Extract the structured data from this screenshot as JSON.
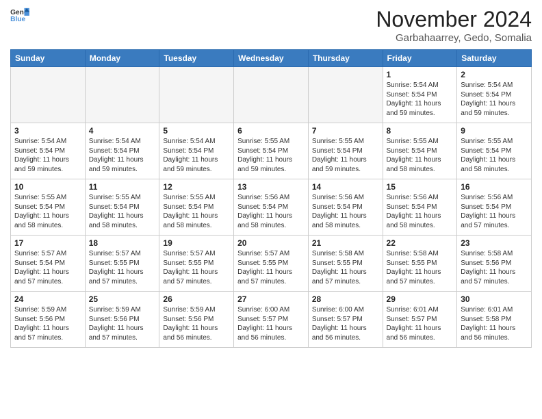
{
  "header": {
    "logo_general": "General",
    "logo_blue": "Blue",
    "month_title": "November 2024",
    "location": "Garbahaarrey, Gedo, Somalia"
  },
  "weekdays": [
    "Sunday",
    "Monday",
    "Tuesday",
    "Wednesday",
    "Thursday",
    "Friday",
    "Saturday"
  ],
  "weeks": [
    [
      {
        "day": "",
        "content": ""
      },
      {
        "day": "",
        "content": ""
      },
      {
        "day": "",
        "content": ""
      },
      {
        "day": "",
        "content": ""
      },
      {
        "day": "",
        "content": ""
      },
      {
        "day": "1",
        "sunrise": "5:54 AM",
        "sunset": "5:54 PM",
        "daylight": "11 hours and 59 minutes."
      },
      {
        "day": "2",
        "sunrise": "5:54 AM",
        "sunset": "5:54 PM",
        "daylight": "11 hours and 59 minutes."
      }
    ],
    [
      {
        "day": "3",
        "sunrise": "5:54 AM",
        "sunset": "5:54 PM",
        "daylight": "11 hours and 59 minutes."
      },
      {
        "day": "4",
        "sunrise": "5:54 AM",
        "sunset": "5:54 PM",
        "daylight": "11 hours and 59 minutes."
      },
      {
        "day": "5",
        "sunrise": "5:54 AM",
        "sunset": "5:54 PM",
        "daylight": "11 hours and 59 minutes."
      },
      {
        "day": "6",
        "sunrise": "5:55 AM",
        "sunset": "5:54 PM",
        "daylight": "11 hours and 59 minutes."
      },
      {
        "day": "7",
        "sunrise": "5:55 AM",
        "sunset": "5:54 PM",
        "daylight": "11 hours and 59 minutes."
      },
      {
        "day": "8",
        "sunrise": "5:55 AM",
        "sunset": "5:54 PM",
        "daylight": "11 hours and 58 minutes."
      },
      {
        "day": "9",
        "sunrise": "5:55 AM",
        "sunset": "5:54 PM",
        "daylight": "11 hours and 58 minutes."
      }
    ],
    [
      {
        "day": "10",
        "sunrise": "5:55 AM",
        "sunset": "5:54 PM",
        "daylight": "11 hours and 58 minutes."
      },
      {
        "day": "11",
        "sunrise": "5:55 AM",
        "sunset": "5:54 PM",
        "daylight": "11 hours and 58 minutes."
      },
      {
        "day": "12",
        "sunrise": "5:55 AM",
        "sunset": "5:54 PM",
        "daylight": "11 hours and 58 minutes."
      },
      {
        "day": "13",
        "sunrise": "5:56 AM",
        "sunset": "5:54 PM",
        "daylight": "11 hours and 58 minutes."
      },
      {
        "day": "14",
        "sunrise": "5:56 AM",
        "sunset": "5:54 PM",
        "daylight": "11 hours and 58 minutes."
      },
      {
        "day": "15",
        "sunrise": "5:56 AM",
        "sunset": "5:54 PM",
        "daylight": "11 hours and 58 minutes."
      },
      {
        "day": "16",
        "sunrise": "5:56 AM",
        "sunset": "5:54 PM",
        "daylight": "11 hours and 57 minutes."
      }
    ],
    [
      {
        "day": "17",
        "sunrise": "5:57 AM",
        "sunset": "5:54 PM",
        "daylight": "11 hours and 57 minutes."
      },
      {
        "day": "18",
        "sunrise": "5:57 AM",
        "sunset": "5:55 PM",
        "daylight": "11 hours and 57 minutes."
      },
      {
        "day": "19",
        "sunrise": "5:57 AM",
        "sunset": "5:55 PM",
        "daylight": "11 hours and 57 minutes."
      },
      {
        "day": "20",
        "sunrise": "5:57 AM",
        "sunset": "5:55 PM",
        "daylight": "11 hours and 57 minutes."
      },
      {
        "day": "21",
        "sunrise": "5:58 AM",
        "sunset": "5:55 PM",
        "daylight": "11 hours and 57 minutes."
      },
      {
        "day": "22",
        "sunrise": "5:58 AM",
        "sunset": "5:55 PM",
        "daylight": "11 hours and 57 minutes."
      },
      {
        "day": "23",
        "sunrise": "5:58 AM",
        "sunset": "5:56 PM",
        "daylight": "11 hours and 57 minutes."
      }
    ],
    [
      {
        "day": "24",
        "sunrise": "5:59 AM",
        "sunset": "5:56 PM",
        "daylight": "11 hours and 57 minutes."
      },
      {
        "day": "25",
        "sunrise": "5:59 AM",
        "sunset": "5:56 PM",
        "daylight": "11 hours and 57 minutes."
      },
      {
        "day": "26",
        "sunrise": "5:59 AM",
        "sunset": "5:56 PM",
        "daylight": "11 hours and 56 minutes."
      },
      {
        "day": "27",
        "sunrise": "6:00 AM",
        "sunset": "5:57 PM",
        "daylight": "11 hours and 56 minutes."
      },
      {
        "day": "28",
        "sunrise": "6:00 AM",
        "sunset": "5:57 PM",
        "daylight": "11 hours and 56 minutes."
      },
      {
        "day": "29",
        "sunrise": "6:01 AM",
        "sunset": "5:57 PM",
        "daylight": "11 hours and 56 minutes."
      },
      {
        "day": "30",
        "sunrise": "6:01 AM",
        "sunset": "5:58 PM",
        "daylight": "11 hours and 56 minutes."
      }
    ]
  ]
}
